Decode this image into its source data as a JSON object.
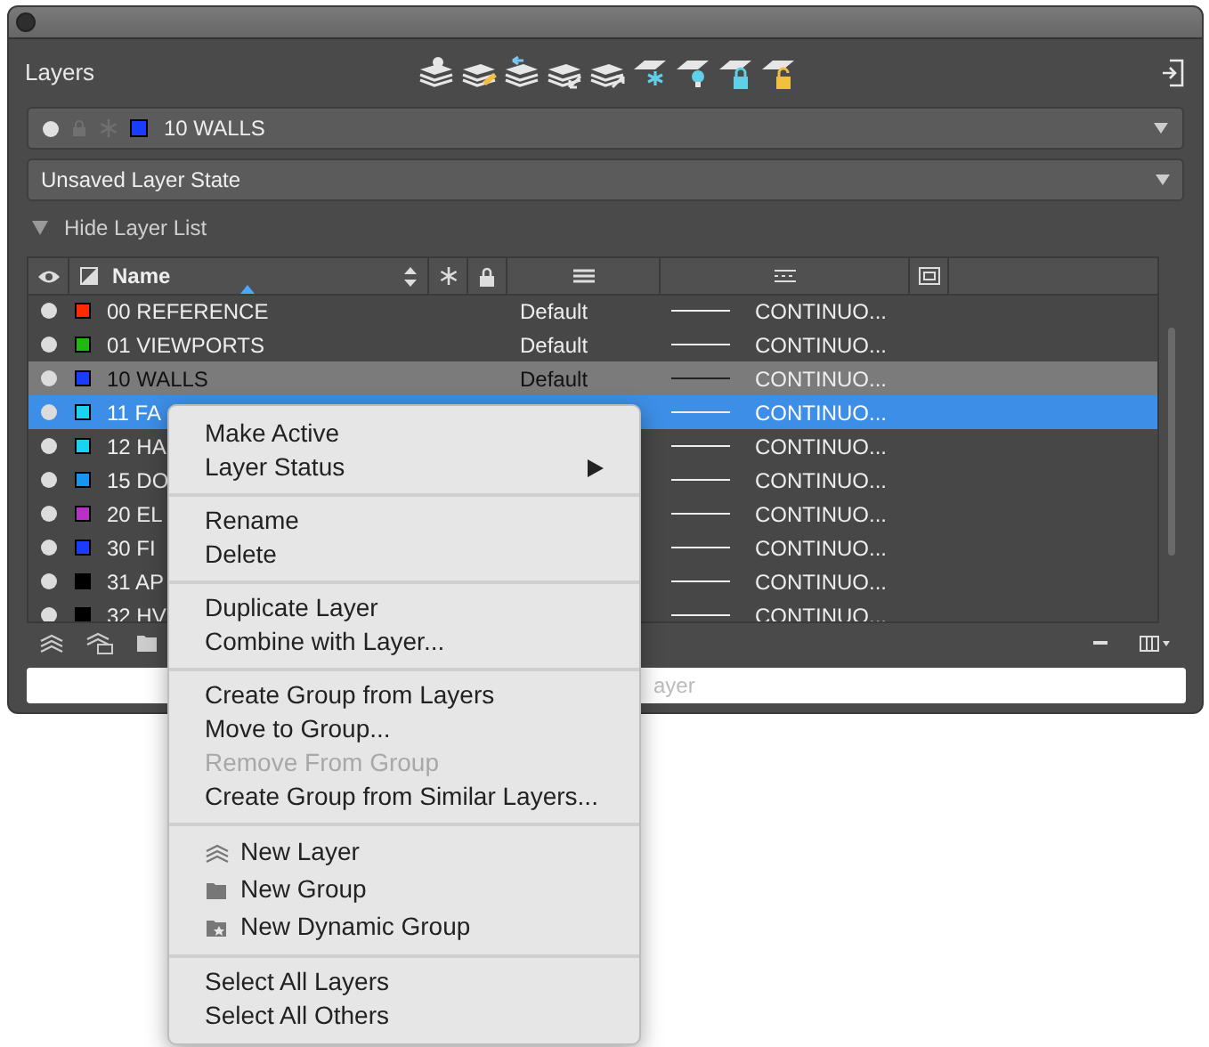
{
  "panel": {
    "title": "Layers"
  },
  "current_layer": {
    "name": "10 WALLS",
    "color": "#1a3cff"
  },
  "layer_state": {
    "value": "Unsaved Layer State"
  },
  "toggle": {
    "label": "Hide Layer List",
    "expanded": true
  },
  "table": {
    "columns": [
      {
        "label": "Name"
      }
    ],
    "rows": [
      {
        "name": "00 REFERENCE",
        "color": "#ff2a00",
        "lineweight": "Default",
        "linetype": "CONTINUO...",
        "selected": false,
        "current": false
      },
      {
        "name": "01 VIEWPORTS",
        "color": "#22b814",
        "lineweight": "Default",
        "linetype": "CONTINUO...",
        "selected": false,
        "current": false
      },
      {
        "name": "10 WALLS",
        "color": "#1a3cff",
        "lineweight": "Default",
        "linetype": "CONTINUO...",
        "selected": false,
        "current": true
      },
      {
        "name": "11 FA",
        "color": "#19d3f0",
        "linetype": "CONTINUO...",
        "selected": true,
        "current": false
      },
      {
        "name": "12 HA",
        "color": "#19d3f0",
        "linetype": "CONTINUO...",
        "selected": false,
        "current": false
      },
      {
        "name": "15 DO",
        "color": "#1796f0",
        "linetype": "CONTINUO...",
        "selected": false,
        "current": false
      },
      {
        "name": "20 EL",
        "color": "#b830c8",
        "linetype": "CONTINUO...",
        "selected": false,
        "current": false
      },
      {
        "name": "30 FI",
        "color": "#1a3cff",
        "linetype": "CONTINUO...",
        "selected": false,
        "current": false
      },
      {
        "name": "31 AP",
        "color": "#000000",
        "linetype": "CONTINUO...",
        "selected": false,
        "current": false
      },
      {
        "name": "32 HV",
        "color": "#000000",
        "linetype": "CONTINUO...",
        "selected": false,
        "current": false
      }
    ]
  },
  "search": {
    "placeholder": "ayer"
  },
  "context_menu": {
    "sections": [
      [
        {
          "label": "Make Active",
          "kind": "plain",
          "disabled": false
        },
        {
          "label": "Layer Status",
          "kind": "submenu",
          "disabled": false
        }
      ],
      [
        {
          "label": "Rename",
          "kind": "plain",
          "disabled": false
        },
        {
          "label": "Delete",
          "kind": "plain",
          "disabled": false
        }
      ],
      [
        {
          "label": "Duplicate Layer",
          "kind": "plain",
          "disabled": false
        },
        {
          "label": "Combine with Layer...",
          "kind": "plain",
          "disabled": false
        }
      ],
      [
        {
          "label": "Create Group from Layers",
          "kind": "plain",
          "disabled": false
        },
        {
          "label": "Move to Group...",
          "kind": "plain",
          "disabled": false
        },
        {
          "label": "Remove From Group",
          "kind": "plain",
          "disabled": true
        },
        {
          "label": "Create Group from Similar Layers...",
          "kind": "plain",
          "disabled": false
        }
      ],
      [
        {
          "label": "New Layer",
          "kind": "layer",
          "disabled": false
        },
        {
          "label": "New Group",
          "kind": "group",
          "disabled": false
        },
        {
          "label": "New Dynamic Group",
          "kind": "dynamic",
          "disabled": false
        }
      ],
      [
        {
          "label": "Select All Layers",
          "kind": "plain",
          "disabled": false
        },
        {
          "label": "Select All Others",
          "kind": "plain",
          "disabled": false
        }
      ]
    ]
  }
}
